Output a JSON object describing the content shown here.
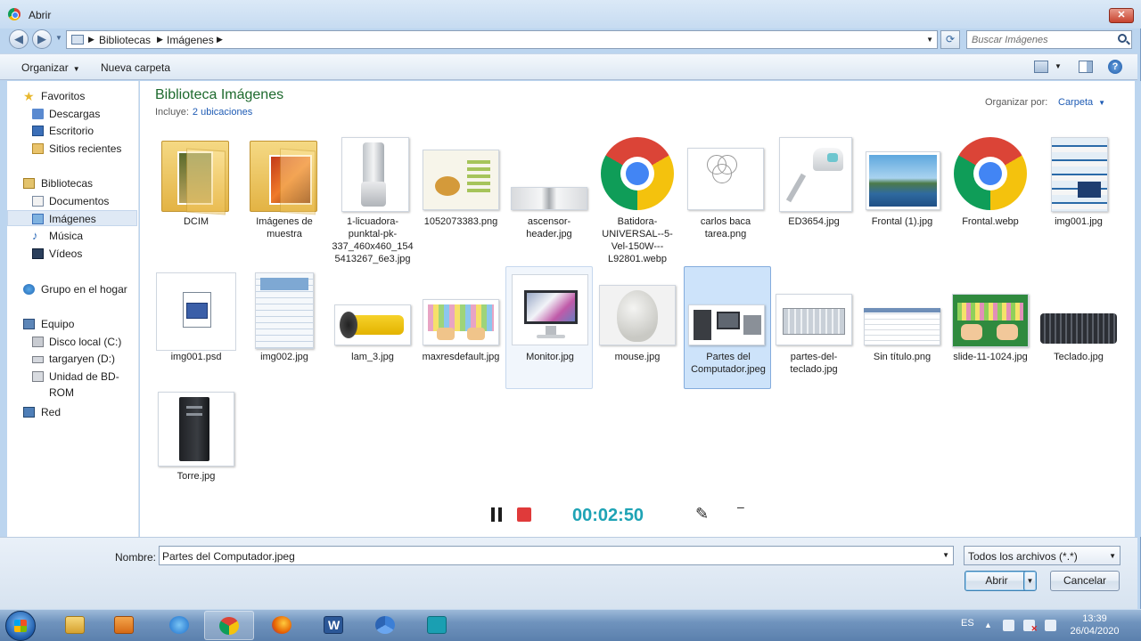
{
  "window": {
    "title": "Abrir",
    "close_glyph": "✕"
  },
  "address": {
    "crumbs": [
      "Bibliotecas",
      "Imágenes"
    ],
    "search_placeholder": "Buscar Imágenes"
  },
  "toolbar": {
    "organize": "Organizar",
    "new_folder": "Nueva carpeta"
  },
  "nav": {
    "favorites": "Favoritos",
    "downloads": "Descargas",
    "desktop": "Escritorio",
    "recent": "Sitios recientes",
    "libraries": "Bibliotecas",
    "documents": "Documentos",
    "images": "Imágenes",
    "music": "Música",
    "videos": "Vídeos",
    "homegroup": "Grupo en el hogar",
    "computer": "Equipo",
    "local_disk": "Disco local (C:)",
    "drive_d": "targaryen (D:)",
    "bd_rom": "Unidad de BD-ROM",
    "network": "Red"
  },
  "library": {
    "title": "Biblioteca Imágenes",
    "includes_label": "Incluye:",
    "locations_link": "2 ubicaciones",
    "arrange_label": "Organizar por:",
    "arrange_value": "Carpeta"
  },
  "files": [
    {
      "name": "DCIM",
      "kind": "folder"
    },
    {
      "name": "Imágenes de muestra",
      "kind": "folder"
    },
    {
      "name": "1-licuadora-punktal-pk-337_460x460_1545413267_6e3.jpg",
      "kind": "image"
    },
    {
      "name": "1052073383.png",
      "kind": "image"
    },
    {
      "name": "ascensor-header.jpg",
      "kind": "image"
    },
    {
      "name": "Batidora-UNIVERSAL--5-Vel-150W---L92801.webp",
      "kind": "chrome"
    },
    {
      "name": "carlos baca tarea.png",
      "kind": "image"
    },
    {
      "name": "ED3654.jpg",
      "kind": "image"
    },
    {
      "name": "Frontal (1).jpg",
      "kind": "image"
    },
    {
      "name": "Frontal.webp",
      "kind": "chrome"
    },
    {
      "name": "img001.jpg",
      "kind": "image"
    },
    {
      "name": "img001.psd",
      "kind": "psd"
    },
    {
      "name": "img002.jpg",
      "kind": "image"
    },
    {
      "name": "lam_3.jpg",
      "kind": "image"
    },
    {
      "name": "maxresdefault.jpg",
      "kind": "image"
    },
    {
      "name": "Monitor.jpg",
      "kind": "image",
      "state": "hover"
    },
    {
      "name": "mouse.jpg",
      "kind": "image"
    },
    {
      "name": "Partes del Computador.jpeg",
      "kind": "image",
      "state": "selected"
    },
    {
      "name": "partes-del-teclado.jpg",
      "kind": "image"
    },
    {
      "name": "Sin título.png",
      "kind": "image"
    },
    {
      "name": "slide-11-1024.jpg",
      "kind": "image"
    },
    {
      "name": "Teclado.jpg",
      "kind": "image"
    },
    {
      "name": "Torre.jpg",
      "kind": "image"
    }
  ],
  "recorder": {
    "time": "00:02:50",
    "minimize": "–"
  },
  "bottom": {
    "name_label": "Nombre:",
    "name_value": "Partes del Computador.jpeg",
    "filter_value": "Todos los archivos (*.*)",
    "open_label": "Abrir",
    "cancel_label": "Cancelar"
  },
  "taskbar": {
    "lang": "ES",
    "time": "13:39",
    "date": "26/04/2020"
  },
  "colors": {
    "title_green": "#1e6a2e",
    "link_blue": "#1e5bb4",
    "selection": "#cde3fa",
    "timer": "#1ea3b5",
    "stop_red": "#e03a3a"
  }
}
